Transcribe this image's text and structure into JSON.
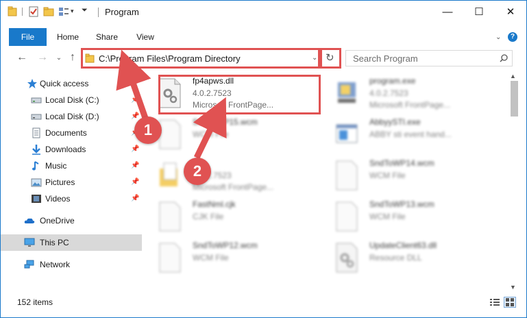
{
  "window": {
    "title": "Program",
    "controls": {
      "minimize": "—",
      "maximize": "☐",
      "close": "✕"
    }
  },
  "ribbon": {
    "tabs": [
      "File",
      "Home",
      "Share",
      "View"
    ],
    "help": "?"
  },
  "address": {
    "path": "C:\\Program Files\\Program Directory",
    "search_placeholder": "Search Program"
  },
  "sidebar": {
    "items": [
      {
        "label": "Quick access",
        "icon": "star-icon"
      },
      {
        "label": "Local Disk (C:)",
        "icon": "drive-icon",
        "pinned": true
      },
      {
        "label": "Local Disk (D:)",
        "icon": "drive-icon",
        "pinned": true
      },
      {
        "label": "Documents",
        "icon": "documents-icon",
        "pinned": true
      },
      {
        "label": "Downloads",
        "icon": "downloads-icon",
        "pinned": true
      },
      {
        "label": "Music",
        "icon": "music-icon",
        "pinned": true
      },
      {
        "label": "Pictures",
        "icon": "pictures-icon",
        "pinned": true
      },
      {
        "label": "Videos",
        "icon": "videos-icon",
        "pinned": true
      },
      {
        "label": "OneDrive",
        "icon": "cloud-icon"
      },
      {
        "label": "This PC",
        "icon": "monitor-icon",
        "selected": true
      },
      {
        "label": "Network",
        "icon": "network-icon"
      }
    ]
  },
  "files": [
    {
      "name": "fp4apws.dll",
      "line1": "4.0.2.7523",
      "line2": "Microsoft FrontPage...",
      "icon": "dll-gear-icon"
    },
    {
      "name": "program.exe",
      "line1": "4.0.2.7523",
      "line2": "Microsoft FrontPage...",
      "icon": "exe-icon"
    },
    {
      "name": "SndToWP15.wcm",
      "line1": "WCM File",
      "line2": "",
      "icon": "blank-file-icon"
    },
    {
      "name": "AbbyySTI.exe",
      "line1": "ABBY sti event hand...",
      "line2": "",
      "icon": "window-icon"
    },
    {
      "name": "",
      "line1": "4.0.2.7523",
      "line2": "Microsoft FrontPage...",
      "icon": "folder-doc-icon"
    },
    {
      "name": "SndToWP14.wcm",
      "line1": "WCM File",
      "line2": "",
      "icon": "blank-file-icon"
    },
    {
      "name": "FastNml.cjk",
      "line1": "CJK File",
      "line2": "",
      "icon": "blank-file-icon"
    },
    {
      "name": "SndToWP13.wcm",
      "line1": "WCM File",
      "line2": "",
      "icon": "blank-file-icon"
    },
    {
      "name": "SndToWP12.wcm",
      "line1": "WCM File",
      "line2": "",
      "icon": "blank-file-icon"
    },
    {
      "name": "UpdateClient63.dll",
      "line1": "Resource DLL",
      "line2": "",
      "icon": "dll-gear-icon"
    }
  ],
  "status": {
    "item_count": "152 items"
  },
  "annotations": {
    "step1": "1",
    "step2": "2"
  },
  "colors": {
    "accent": "#1979ca",
    "highlight": "#e05252",
    "selected": "#d9d9d9"
  }
}
